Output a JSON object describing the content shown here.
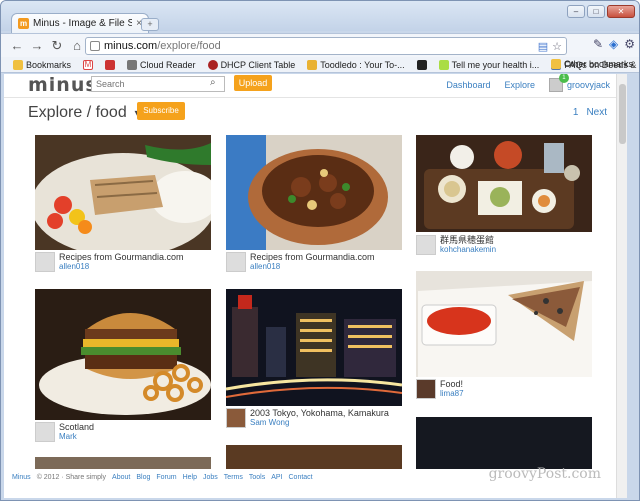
{
  "browser": {
    "tab_title": "Minus - Image & File Sharin",
    "tab_close": "×",
    "new_tab": "+",
    "url_host": "minus.com",
    "url_path": "/explore/food",
    "win_min": "–",
    "win_max": "□",
    "win_close": "✕"
  },
  "bookmarks": {
    "items": [
      {
        "label": "Bookmarks",
        "color": "#f0c040"
      },
      {
        "label": "",
        "color": "#d44"
      },
      {
        "label": "",
        "color": "#c33"
      },
      {
        "label": "Cloud Reader",
        "color": "#777"
      },
      {
        "label": "DHCP Client Table",
        "color": "#a22"
      },
      {
        "label": "Toodledo : Your To-...",
        "color": "#e9b233"
      },
      {
        "label": "",
        "color": "#222"
      },
      {
        "label": "Tell me your health i...",
        "color": "#ad4"
      },
      {
        "label": "FAQs on Deeds & M...",
        "color": "#5577aa"
      }
    ],
    "other": "Other bookmarks"
  },
  "site": {
    "logo": "minus",
    "search_placeholder": "Search",
    "upload": "Upload",
    "nav": {
      "dashboard": "Dashboard",
      "explore": "Explore",
      "user": "groovyjack",
      "notif_count": "1"
    },
    "page_title": "Explore / food",
    "subscribe": "Subscribe",
    "pager": {
      "page": "1",
      "next": "Next"
    }
  },
  "cards": [
    {
      "title": "Recipes from Gourmandia.com",
      "user": "allen018"
    },
    {
      "title": "Recipes from Gourmandia.com",
      "user": "allen018"
    },
    {
      "title": "群馬県穂蛋館",
      "user": "kohchanakemin"
    },
    {
      "title": "Scotland",
      "user": "Mark"
    },
    {
      "title": "2003 Tokyo, Yokohama, Kamakura",
      "user": "Sam Wong"
    },
    {
      "title": "Food!",
      "user": "lima87"
    }
  ],
  "footer": {
    "brand": "Minus",
    "copy": "© 2012 · Share simply",
    "links": [
      "About",
      "Blog",
      "Forum",
      "Help",
      "Jobs",
      "Terms",
      "Tools",
      "API",
      "Contact"
    ]
  },
  "watermark": "groovyPost.com"
}
